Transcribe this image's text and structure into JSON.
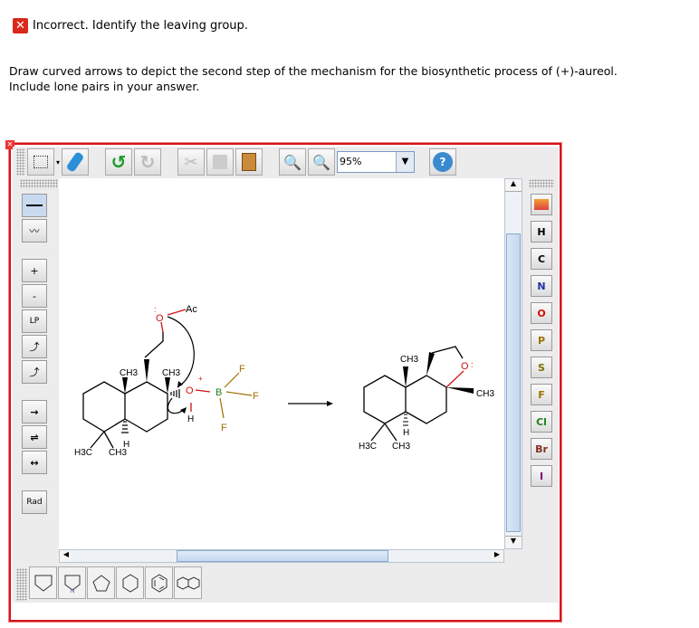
{
  "status": {
    "icon": "x-icon",
    "text": "Incorrect. Identify the leaving group."
  },
  "instructions": {
    "line1": "Draw curved arrows to depict the second step of the mechanism for the biosynthetic process of (+)-aureol.",
    "line2": "Include lone pairs in your answer."
  },
  "toolbar": {
    "zoom_value": "95%",
    "help": "?"
  },
  "left_tools": [
    "single-bond",
    "chain",
    "+",
    "-",
    "LP",
    "curved-arrow-pair",
    "curved-arrow-single",
    "reaction-arrow",
    "equilibrium-arrow",
    "resonance-arrow",
    "Rad"
  ],
  "left_labels": {
    "plus": "+",
    "minus": "-",
    "lp": "LP",
    "rad": "Rad"
  },
  "elements": [
    "H",
    "C",
    "N",
    "O",
    "P",
    "S",
    "F",
    "Cl",
    "Br",
    "I"
  ],
  "element_colors": {
    "H": "#000",
    "C": "#000",
    "N": "#2230a0",
    "O": "#d01010",
    "P": "#a07000",
    "S": "#807000",
    "F": "#a07000",
    "Cl": "#208020",
    "Br": "#803020",
    "I": "#800080"
  },
  "templates": [
    "cyclopentane-house",
    "pyrrole",
    "cyclopentane",
    "cyclohexane",
    "benzene",
    "naphthalene"
  ],
  "molecule": {
    "ch3": "CH3",
    "ch": "CH",
    "sub3": "3",
    "h3c": "H3C",
    "h": "H",
    "o": "O",
    "ac": "Ac",
    "b": "B",
    "f": "F",
    "plus": "+",
    "minus": "-"
  }
}
